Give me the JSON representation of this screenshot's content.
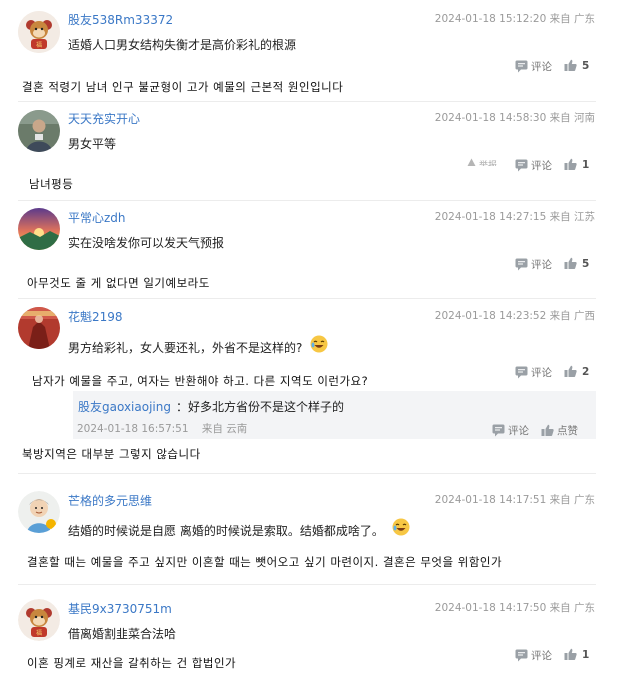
{
  "comments": [
    {
      "user": "股友538Rm33372",
      "datetime": "2024-01-18 15:12:20",
      "location": "来自 广东",
      "text": "适婚人口男女结构失衡才是高价彩礼的根源",
      "translation": "결혼 적령기 남녀 인구 불균형이 고가 예물의 근본적 원인입니다",
      "comment_label": "评论",
      "likes": "5"
    },
    {
      "user": "天天充实开心",
      "datetime": "2024-01-18 14:58:30",
      "location": "来自 河南",
      "text": "男女平等",
      "translation": "남녀평등",
      "report_label": "举报",
      "comment_label": "评论",
      "likes": "1"
    },
    {
      "user": "平常心zdh",
      "datetime": "2024-01-18 14:27:15",
      "location": "来自 江苏",
      "text": "实在没啥发你可以发天气预报",
      "translation": "아무것도 줄 게 없다면 일기예보라도",
      "comment_label": "评论",
      "likes": "5"
    },
    {
      "user": "花魁2198",
      "datetime": "2024-01-18 14:23:52",
      "location": "来自 广西",
      "text": "男方给彩礼，女人要还礼，外省不是这样的?",
      "translation": "남자가 예물을 주고, 여자는 반환해야 하고. 다른 지역도 이런가요?",
      "comment_label": "评论",
      "likes": "2",
      "reply": {
        "user": "股友gaoxiaojing",
        "text": "：好多北方省份不是这个样子的",
        "datetime": "2024-01-18 16:57:51",
        "location": "来自 云南",
        "comment_label": "评论",
        "like_label": "点赞"
      },
      "reply_translation": "북방지역은 대부분 그렇지 않습니다"
    },
    {
      "user": "芒格的多元思维",
      "datetime": "2024-01-18 14:17:51",
      "location": "来自 广东",
      "text": "结婚的时候说是自愿 离婚的时候说是索取。结婚都成啥了。",
      "translation": "결혼할 때는 예물을 주고 싶지만 이혼할 때는 뺏어오고 싶기 마련이지. 결혼은 무엇을 위함인가"
    },
    {
      "user": "基民9x3730751m",
      "datetime": "2024-01-18 14:17:50",
      "location": "来自 广东",
      "text": "借离婚割韭菜合法哈",
      "translation": "이혼 핑계로 재산을 갈취하는 건 합법인가",
      "comment_label": "评论",
      "likes": "1"
    }
  ],
  "colors": {
    "username": "#3b78c6",
    "meta": "#9a9a9a",
    "separator": "#ececec"
  }
}
